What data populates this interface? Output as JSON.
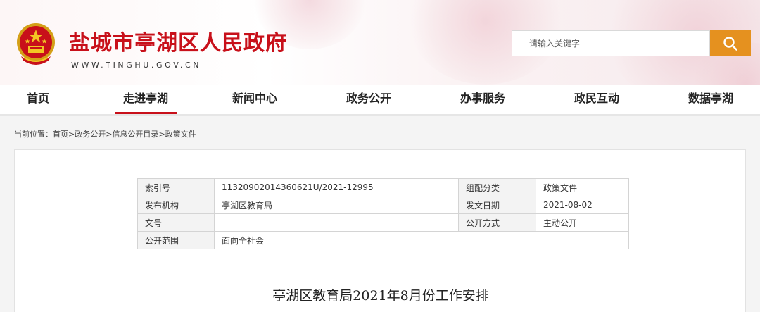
{
  "header": {
    "site_title": "盐城市亭湖区人民政府",
    "site_domain": "WWW.TINGHU.GOV.CN",
    "search_placeholder": "请输入关键字",
    "search_button_icon": "search-icon",
    "emblem_icon": "national-emblem-icon"
  },
  "nav": {
    "items": [
      {
        "label": "首页",
        "active": false
      },
      {
        "label": "走进亭湖",
        "active": true
      },
      {
        "label": "新闻中心",
        "active": false
      },
      {
        "label": "政务公开",
        "active": false
      },
      {
        "label": "办事服务",
        "active": false
      },
      {
        "label": "政民互动",
        "active": false
      },
      {
        "label": "数据亭湖",
        "active": false
      }
    ]
  },
  "breadcrumb": {
    "prefix": "当前位置：",
    "items": [
      "首页",
      "政务公开",
      "信息公开目录",
      "政策文件"
    ],
    "separator": ">"
  },
  "info_table": {
    "rows": [
      {
        "label1": "索引号",
        "value1": "11320902014360621U/2021-12995",
        "label2": "组配分类",
        "value2": "政策文件"
      },
      {
        "label1": "发布机构",
        "value1": "亭湖区教育局",
        "label2": "发文日期",
        "value2": "2021-08-02"
      },
      {
        "label1": "文号",
        "value1": "",
        "label2": "公开方式",
        "value2": "主动公开"
      },
      {
        "label1": "公开范围",
        "value1": "面向全社会"
      }
    ]
  },
  "document": {
    "title": "亭湖区教育局2021年8月份工作安排"
  },
  "colors": {
    "brand_red": "#c8101a",
    "search_orange": "#e5911f"
  }
}
